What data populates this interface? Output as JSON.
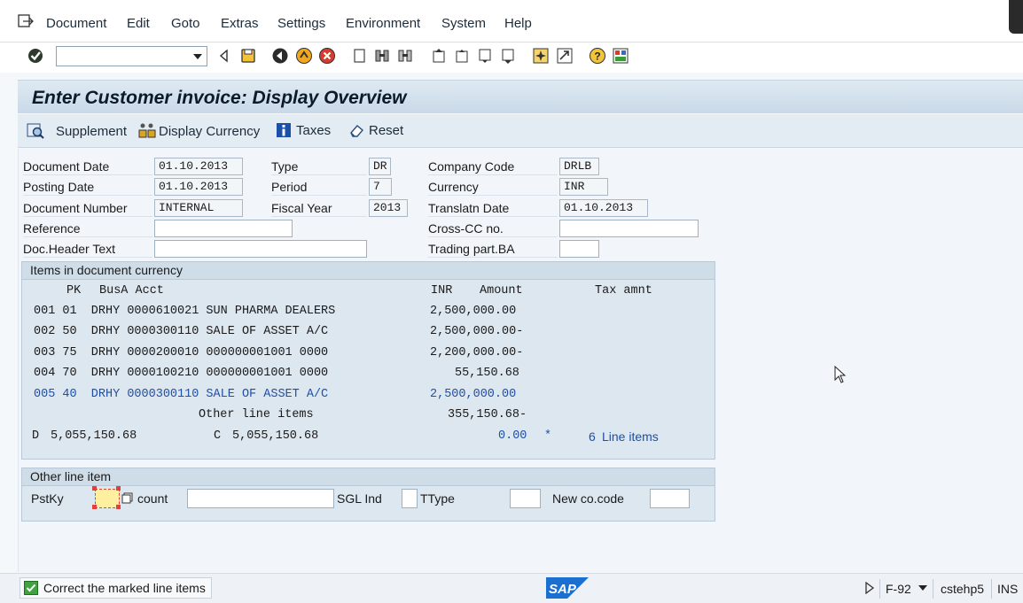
{
  "menu": {
    "items": [
      "Document",
      "Edit",
      "Goto",
      "Extras",
      "Settings",
      "Environment",
      "System",
      "Help"
    ]
  },
  "toolbar": {
    "command_value": ""
  },
  "title": "Enter Customer invoice: Display Overview",
  "app_toolbar": {
    "supplement": "Supplement",
    "display_currency": "Display Currency",
    "taxes": "Taxes",
    "reset": "Reset"
  },
  "header": {
    "document_date": {
      "label": "Document Date",
      "value": "01.10.2013"
    },
    "posting_date": {
      "label": "Posting Date",
      "value": "01.10.2013"
    },
    "document_number": {
      "label": "Document Number",
      "value": "INTERNAL"
    },
    "reference": {
      "label": "Reference",
      "value": ""
    },
    "doc_header_text": {
      "label": "Doc.Header Text",
      "value": ""
    },
    "type": {
      "label": "Type",
      "value": "DR"
    },
    "period": {
      "label": "Period",
      "value": "7"
    },
    "fiscal_year": {
      "label": "Fiscal Year",
      "value": "2013"
    },
    "company_code": {
      "label": "Company Code",
      "value": "DRLB"
    },
    "currency": {
      "label": "Currency",
      "value": "INR"
    },
    "translatn_date": {
      "label": "Translatn Date",
      "value": "01.10.2013"
    },
    "cross_cc": {
      "label": "Cross-CC no.",
      "value": ""
    },
    "trading_part": {
      "label": "Trading part.BA",
      "value": ""
    }
  },
  "items": {
    "group_title": "Items in document currency",
    "columns": {
      "pk": "PK",
      "busa_acct": "BusA Acct",
      "currency": "INR",
      "amount": "Amount",
      "tax": "Tax amnt"
    },
    "rows": [
      {
        "text": "001 01  DRHY 0000610021 SUN PHARMA DEALERS",
        "amount": "2,500,000.00"
      },
      {
        "text": "002 50  DRHY 0000300110 SALE OF ASSET A/C",
        "amount": "2,500,000.00-"
      },
      {
        "text": "003 75  DRHY 0000200010 000000001001 0000",
        "amount": "2,200,000.00-"
      },
      {
        "text": "004 70  DRHY 0000100210 000000001001 0000",
        "amount": "55,150.68"
      },
      {
        "text": "005 40  DRHY 0000300110 SALE OF ASSET A/C",
        "amount": "2,500,000.00"
      }
    ],
    "other_label": "Other line items",
    "other_amount": "355,150.68-",
    "debit_prefix": "D",
    "debit_total": "5,055,150.68",
    "credit_prefix": "C",
    "credit_total": "5,055,150.68",
    "balance": "0.00",
    "balance_flag": "*",
    "line_count": "6",
    "line_items_label": "Line items"
  },
  "other_line_item": {
    "title": "Other line item",
    "pstky_label": "PstKy",
    "pstky_value": "",
    "account_label": "count",
    "account_value": "",
    "sgl_label": "SGL Ind",
    "sgl_value": "",
    "ttype_label": "TType",
    "ttype_value": "",
    "new_cocode_label": "New co.code",
    "new_cocode_value": ""
  },
  "status": {
    "message": "Correct the marked line items",
    "tcode": "F-92",
    "server": "cstehp5",
    "mode": "INS"
  },
  "colors": {
    "title_bg": "#c9d9e8",
    "group_bg": "#dde7f0",
    "highlight_row": "#1f4fa8",
    "required_field": "#fff0a0"
  }
}
